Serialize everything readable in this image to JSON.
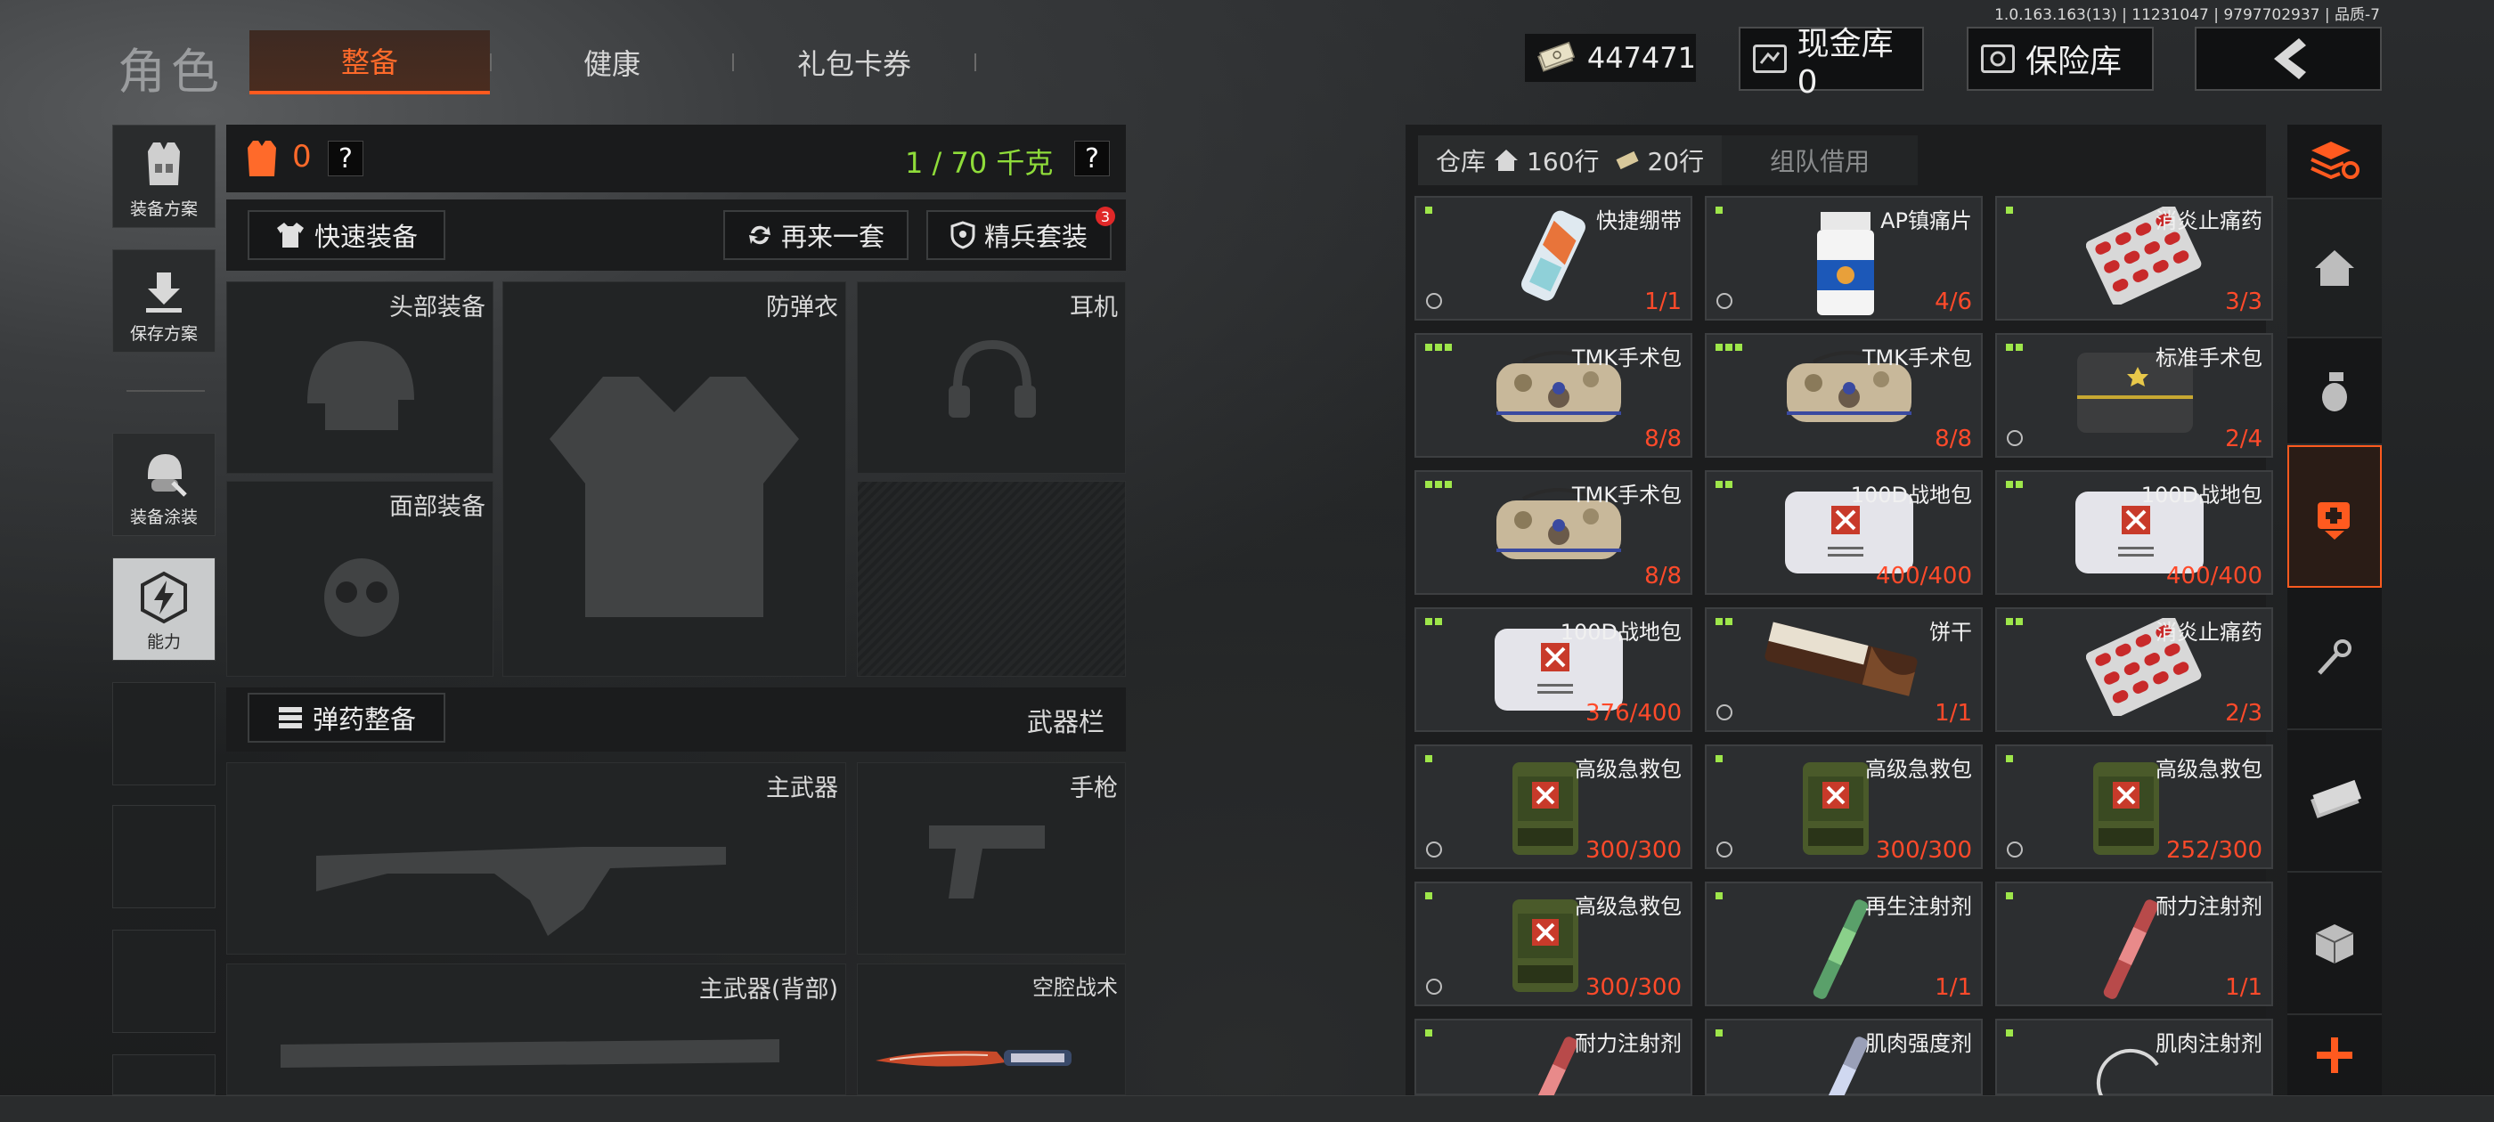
{
  "version": "1.0.163.163(13) | 11231047 | 9797702937 | 品质-7",
  "header": {
    "title": "角色",
    "tabs": [
      {
        "label": "整备",
        "active": true
      },
      {
        "label": "健康",
        "active": false
      },
      {
        "label": "礼包卡券",
        "active": false
      }
    ],
    "currency_value": "447471",
    "cash_vault_label": "现金库 0",
    "safe_box_label": "保险库"
  },
  "left_menu": {
    "items": [
      {
        "label": "装备方案",
        "icon": "vest-icon"
      },
      {
        "label": "保存方案",
        "icon": "download-icon"
      },
      {
        "label": "装备涂装",
        "icon": "helmet-paint-icon"
      },
      {
        "label": "能力",
        "icon": "lightning-hex-icon",
        "active": true
      }
    ]
  },
  "loadout": {
    "armor_count": "0",
    "weight": "1 / 70 千克",
    "quick_equip": "快速装备",
    "re_equip": "再来一套",
    "elite_set": "精兵套装",
    "elite_badge": "3",
    "ammo_equip": "弹药整备",
    "weapon_bar": "武器栏",
    "slots": {
      "head": "头部装备",
      "armor": "防弹衣",
      "ear": "耳机",
      "face": "面部装备",
      "primary": "主武器",
      "pistol": "手枪",
      "primary_back": "主武器(背部)",
      "melee": "空腔战术"
    }
  },
  "inventory": {
    "tab_storage": "仓库",
    "rows_home": "160行",
    "rows_ticket": "20行",
    "tab_team": "组队借用",
    "items": [
      {
        "name": "快捷绷带",
        "qty": "1/1",
        "dots": 1,
        "art": "bandage"
      },
      {
        "name": "AP镇痛片",
        "qty": "4/6",
        "dots": 1,
        "art": "pillbottle"
      },
      {
        "name": "消炎止痛药",
        "qty": "3/3",
        "dots": 1,
        "art": "blister"
      },
      {
        "name": "TMK手术包",
        "qty": "8/8",
        "dots": 3,
        "art": "camobag"
      },
      {
        "name": "TMK手术包",
        "qty": "8/8",
        "dots": 3,
        "art": "camobag"
      },
      {
        "name": "标准手术包",
        "qty": "2/4",
        "dots": 2,
        "art": "darkbag"
      },
      {
        "name": "TMK手术包",
        "qty": "8/8",
        "dots": 3,
        "art": "camobag"
      },
      {
        "name": "100D战地包",
        "qty": "400/400",
        "dots": 2,
        "art": "whitebag"
      },
      {
        "name": "100D战地包",
        "qty": "400/400",
        "dots": 2,
        "art": "whitebag"
      },
      {
        "name": "100D战地包",
        "qty": "376/400",
        "dots": 2,
        "art": "whitebag"
      },
      {
        "name": "饼干",
        "qty": "1/1",
        "dots": 2,
        "art": "biscuit"
      },
      {
        "name": "消炎止痛药",
        "qty": "2/3",
        "dots": 2,
        "art": "blister"
      },
      {
        "name": "高级急救包",
        "qty": "300/300",
        "dots": 1,
        "art": "medkit"
      },
      {
        "name": "高级急救包",
        "qty": "300/300",
        "dots": 1,
        "art": "medkit"
      },
      {
        "name": "高级急救包",
        "qty": "252/300",
        "dots": 1,
        "art": "medkit"
      },
      {
        "name": "高级急救包",
        "qty": "300/300",
        "dots": 1,
        "art": "medkit"
      },
      {
        "name": "再生注射剂",
        "qty": "1/1",
        "dots": 1,
        "art": "injector-green"
      },
      {
        "name": "耐力注射剂",
        "qty": "1/1",
        "dots": 1,
        "art": "injector-red"
      },
      {
        "name": "耐力注射剂",
        "qty": "",
        "dots": 1,
        "art": "injector-red"
      },
      {
        "name": "肌肉强度剂",
        "qty": "",
        "dots": 1,
        "art": "injector-blue"
      },
      {
        "name": "肌肉注射剂",
        "qty": "",
        "dots": 1,
        "art": "ring"
      }
    ]
  },
  "colors": {
    "accent": "#ff5a1f",
    "qty": "#ff4a2a",
    "weight": "#8fdc3a",
    "rarity_dot": "#9ee64a"
  }
}
